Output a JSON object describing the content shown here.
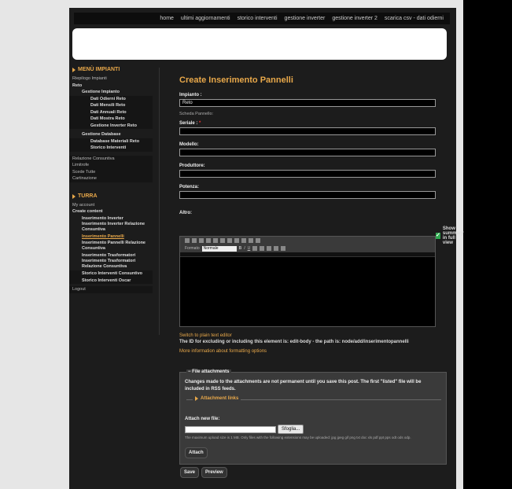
{
  "topnav": [
    "home",
    "ultimi aggiornamenti",
    "storico interventi",
    "gestione inverter",
    "gestione inverter 2",
    "scarica csv - dati odierni"
  ],
  "menu_impianti": {
    "title": "MENÙ IMPIANTI",
    "items": [
      "Riepilogo Impianti",
      "Reto",
      "Gestione Impianto",
      "Dati Odierni Reto",
      "Dati Mensili Reto",
      "Dati Annuali Reto",
      "Dati Mostra Reto",
      "Gestione Inverter Reto",
      "Gestione Database",
      "Database Materiali Reto",
      "Storico Interventi",
      "Relazione Consuntiva",
      "Limitrofe",
      "Scede Tutte",
      "Cartinazione"
    ]
  },
  "menu_turra": {
    "title": "TURRA",
    "items": [
      "My account",
      "Create content",
      "Inserimento Inverter",
      "Inserimento Inverter Relazione Consuntiva",
      "Inserimento Pannelli",
      "Inserimento Pannelli Relazione Consuntiva",
      "Inserimento Trasformatori",
      "Inserimento Trasformatori Relazione Consuntiva",
      "Storico Interventi Consuntivo",
      "Storico Interventi Oscar",
      "Logout"
    ]
  },
  "form": {
    "title": "Create Inserimento Pannelli",
    "impianto_label": "Impianto :",
    "impianto_value": "Reto",
    "scheda_label": "Scheda Pannello:",
    "seriale_label": "Seriale : ",
    "required_mark": "*",
    "modello_label": "Modello:",
    "produttore_label": "Produttore:",
    "potenza_label": "Potenza:",
    "altro_label": "Altro:",
    "show_summary": "Show summary in full view",
    "editor_styles_label": "Formato",
    "editor_format": "Normale",
    "switch_plain": "Switch to plain text editor",
    "id_note": "The ID for excluding or including this element is: edit-body - the path is: node/add/inserimentopannelli",
    "more_info": "More information about formatting options"
  },
  "attachments": {
    "legend": "File attachments",
    "note": "Changes made to the attachments are not permanent until you save this post. The first \"listed\" file will be included in RSS feeds.",
    "inner_legend": "Attachment links",
    "attach_label": "Attach new file:",
    "browse": "Sfoglia...",
    "limits": "The maximum upload size is 1 MB. Only files with the following extensions may be uploaded: jpg jpeg gif png txt doc xls pdf ppt pps odt ods odp.",
    "attach_button": "Attach"
  },
  "buttons": {
    "save": "Save",
    "preview": "Preview"
  }
}
